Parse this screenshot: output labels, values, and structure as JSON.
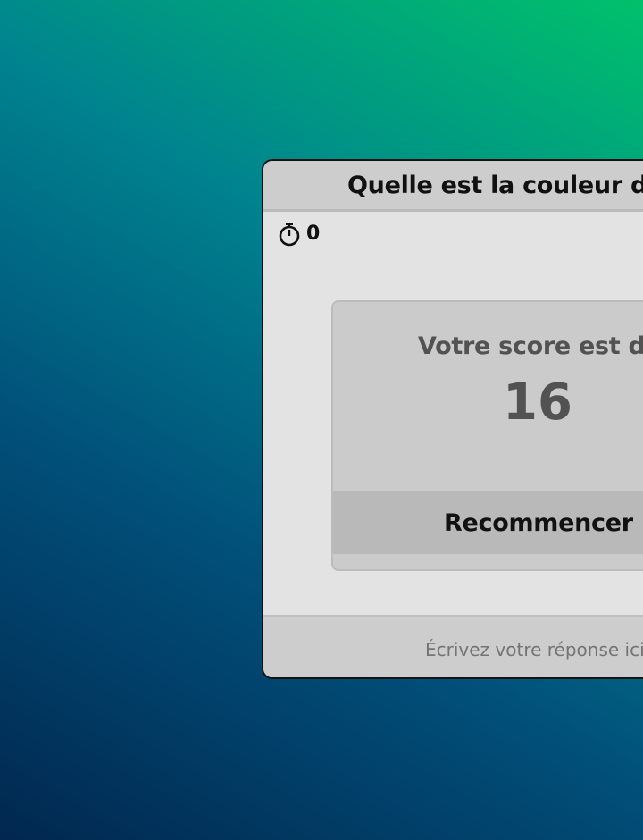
{
  "background": {
    "colors": [
      "#01274f",
      "#01507a",
      "#00838f",
      "#00c16b"
    ]
  },
  "quiz": {
    "question": "Quelle est la couleur du",
    "timer": {
      "icon": "stopwatch-icon",
      "value": "0"
    },
    "result": {
      "label": "Votre score est de",
      "score": "16"
    },
    "restart_label": "Recommencer",
    "answer_placeholder": "Écrivez votre réponse ici"
  }
}
